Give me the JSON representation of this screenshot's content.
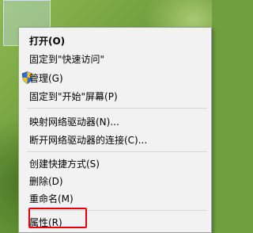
{
  "context_menu": {
    "items": [
      {
        "label": "打开(O)",
        "bold": true
      },
      {
        "label": "固定到\"快速访问\""
      },
      {
        "label": "管理(G)",
        "icon": "uac-shield-icon"
      },
      {
        "label": "固定到\"开始\"屏幕(P)"
      },
      {
        "label": "映射网络驱动器(N)..."
      },
      {
        "label": "断开网络驱动器的连接(C)..."
      },
      {
        "label": "创建快捷方式(S)"
      },
      {
        "label": "删除(D)"
      },
      {
        "label": "重命名(M)"
      },
      {
        "label": "属性(R)"
      }
    ]
  },
  "highlight_color": "#e60000"
}
